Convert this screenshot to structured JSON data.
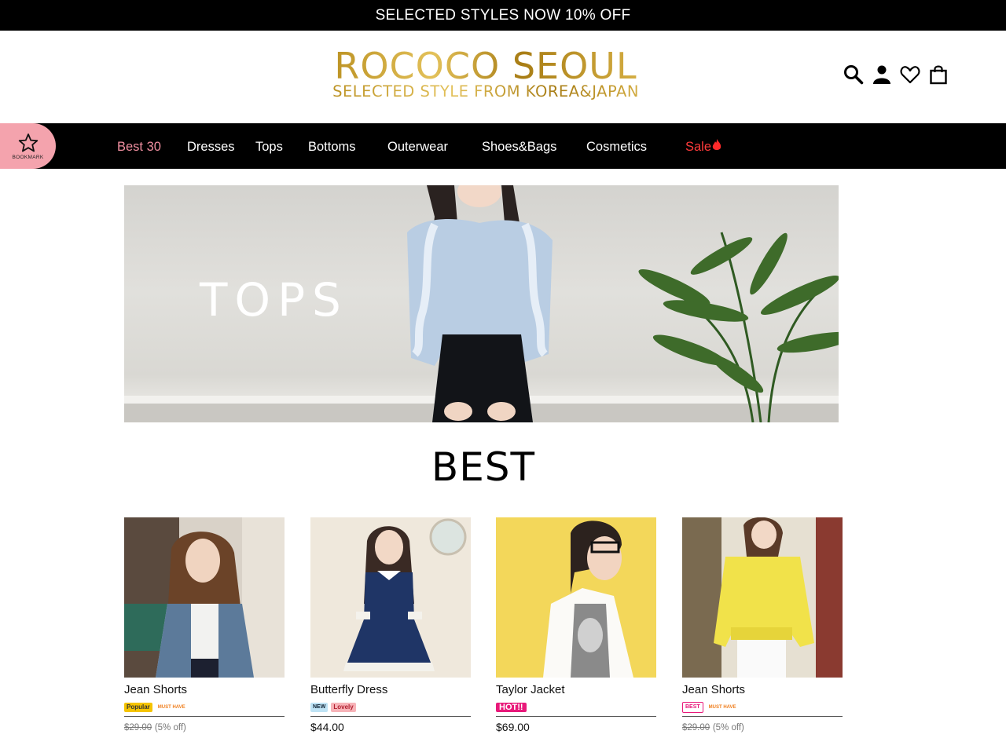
{
  "promo": {
    "text": "SELECTED STYLES NOW 10% OFF"
  },
  "logo": {
    "title": "ROCOCO SEOUL",
    "subtitle": "SELECTED STYLE FROM KOREA&JAPAN",
    "color": "#c9a227"
  },
  "header_icons": [
    "search-icon",
    "account-icon",
    "wishlist-heart-icon",
    "shopping-bag-icon"
  ],
  "bookmark": {
    "label": "BOOKMARK",
    "color": "#f4a3ad"
  },
  "nav": {
    "items": [
      {
        "label": "Best 30"
      },
      {
        "label": "Dresses"
      },
      {
        "label": "Tops"
      },
      {
        "label": "Bottoms"
      },
      {
        "label": "Outerwear"
      },
      {
        "label": "Shoes&Bags"
      },
      {
        "label": "Cosmetics"
      },
      {
        "label": "Sale"
      }
    ]
  },
  "banner": {
    "text": "TOPS"
  },
  "best": {
    "heading": "BEST"
  },
  "products": [
    {
      "name": "Jean Shorts",
      "badges": [
        "Popular",
        "MUST HAVE"
      ],
      "old_price": "$29.00",
      "discount": "(5% off)"
    },
    {
      "name": "Butterfly Dress",
      "badges": [
        "NEW",
        "Lovely"
      ],
      "price": "$44.00"
    },
    {
      "name": "Taylor Jacket",
      "badges": [
        "HOT!!"
      ],
      "price": "$69.00"
    },
    {
      "name": "Jean Shorts",
      "badges": [
        "BEST",
        "MUST HAVE"
      ],
      "old_price": "$29.00",
      "discount": "(5% off)"
    }
  ],
  "colors": {
    "nav_bg": "#000000",
    "accent_pink": "#f08fa0",
    "sale_red": "#ff3b3b"
  }
}
